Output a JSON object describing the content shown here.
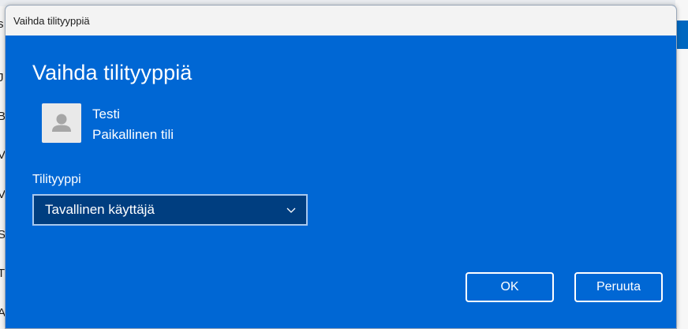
{
  "dialog": {
    "title": "Vaihda tilityyppiä",
    "heading": "Vaihda tilityyppiä",
    "user": {
      "name": "Testi",
      "type": "Paikallinen tili"
    },
    "account_type_label": "Tilityyppi",
    "account_type_value": "Tavallinen käyttäjä",
    "ok_label": "OK",
    "cancel_label": "Peruuta"
  },
  "background": {
    "letters": [
      "s",
      "J",
      "B",
      "V",
      "V",
      "S",
      "T",
      "A"
    ]
  },
  "colors": {
    "dialog_bg": "#0067d4",
    "dropdown_bg": "#003e80",
    "titlebar_bg": "#f3f3f3"
  },
  "icons": {
    "avatar": "person-icon",
    "dropdown": "chevron-down-icon"
  }
}
